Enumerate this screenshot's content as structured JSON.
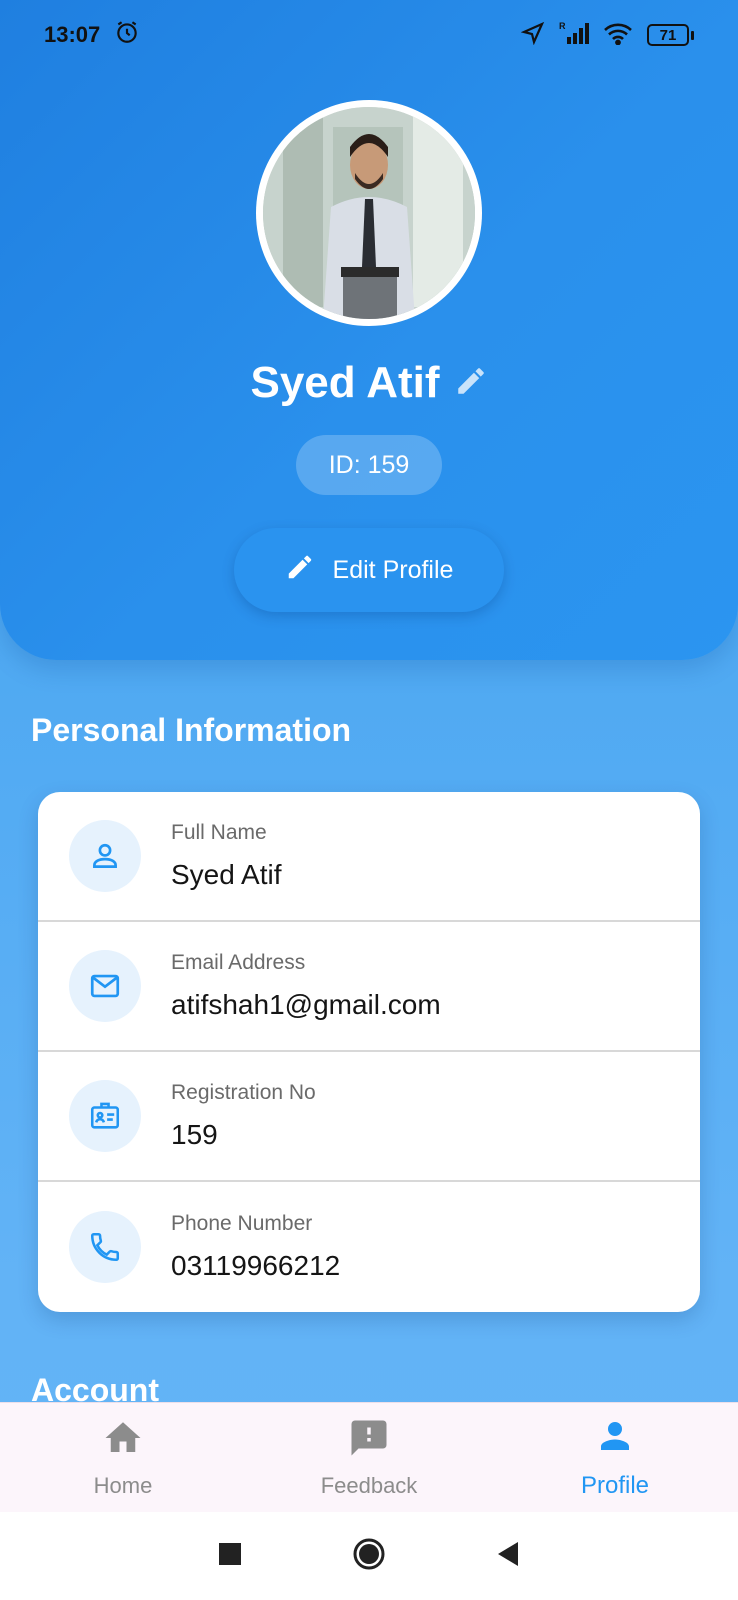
{
  "status_bar": {
    "time": "13:07",
    "battery": "71",
    "icons": [
      "alarm-icon",
      "location-arrow-icon",
      "signal-icon",
      "wifi-icon",
      "battery-icon"
    ]
  },
  "profile": {
    "name": "Syed Atif",
    "id_label": "ID: 159",
    "edit_button_label": "Edit Profile"
  },
  "personal_info": {
    "section_title": "Personal Information",
    "rows": [
      {
        "icon": "person-icon",
        "label": "Full Name",
        "value": "Syed Atif"
      },
      {
        "icon": "mail-icon",
        "label": "Email Address",
        "value": "atifshah1@gmail.com"
      },
      {
        "icon": "id-badge-icon",
        "label": "Registration No",
        "value": "159"
      },
      {
        "icon": "phone-icon",
        "label": "Phone Number",
        "value": "03119966212"
      }
    ]
  },
  "account": {
    "section_title": "Account"
  },
  "bottom_nav": {
    "items": [
      {
        "icon": "home-icon",
        "label": "Home",
        "active": false
      },
      {
        "icon": "feedback-icon",
        "label": "Feedback",
        "active": false
      },
      {
        "icon": "profile-icon",
        "label": "Profile",
        "active": true
      }
    ]
  },
  "colors": {
    "primary": "#2196f3",
    "header": "#2a90ec",
    "icon_bg": "#e6f2fd"
  }
}
